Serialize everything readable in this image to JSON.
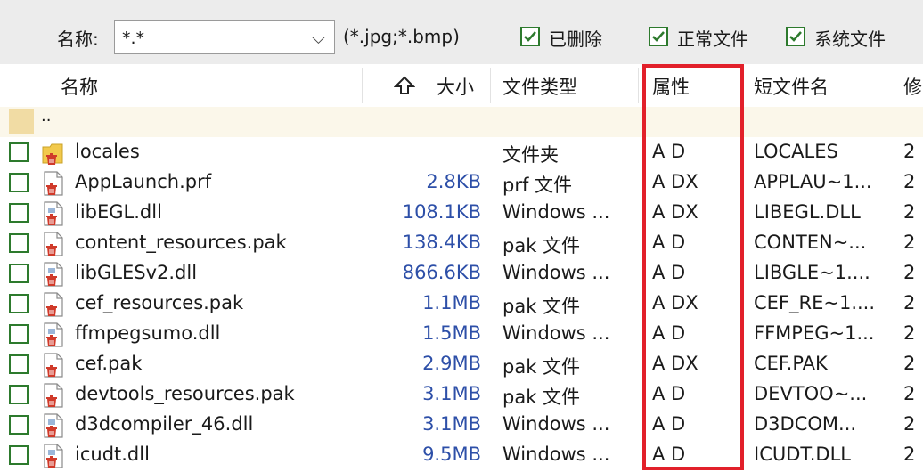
{
  "filter": {
    "name_label": "名称:",
    "pattern_value": "*.*",
    "pattern_hint": "(*.jpg;*.bmp)",
    "checkboxes": [
      {
        "label": "已删除",
        "checked": true
      },
      {
        "label": "正常文件",
        "checked": true
      },
      {
        "label": "系统文件",
        "checked": true
      }
    ]
  },
  "columns": {
    "name": "名称",
    "size": "大小",
    "type": "文件类型",
    "attr": "属性",
    "short": "短文件名",
    "more": "修"
  },
  "parent_row": {
    "label": ".."
  },
  "rows": [
    {
      "name": "locales",
      "size": "",
      "type": "文件夹",
      "attr": "A D",
      "short": "LOCALES",
      "more": "2",
      "kind": "folder"
    },
    {
      "name": "AppLaunch.prf",
      "size": "2.8KB",
      "type": "prf 文件",
      "attr": "A DX",
      "short": "APPLAU~1...",
      "more": "2",
      "kind": "file"
    },
    {
      "name": "libEGL.dll",
      "size": "108.1KB",
      "type": "Windows ...",
      "attr": "A DX",
      "short": "LIBEGL.DLL",
      "more": "2",
      "kind": "dll"
    },
    {
      "name": "content_resources.pak",
      "size": "138.4KB",
      "type": "pak 文件",
      "attr": "A D",
      "short": "CONTEN~...",
      "more": "2",
      "kind": "file"
    },
    {
      "name": "libGLESv2.dll",
      "size": "866.6KB",
      "type": "Windows ...",
      "attr": "A D",
      "short": "LIBGLE~1....",
      "more": "2",
      "kind": "dll"
    },
    {
      "name": "cef_resources.pak",
      "size": "1.1MB",
      "type": "pak 文件",
      "attr": "A DX",
      "short": "CEF_RE~1....",
      "more": "2",
      "kind": "file"
    },
    {
      "name": "ffmpegsumo.dll",
      "size": "1.5MB",
      "type": "Windows ...",
      "attr": "A D",
      "short": "FFMPEG~1...",
      "more": "2",
      "kind": "dll"
    },
    {
      "name": "cef.pak",
      "size": "2.9MB",
      "type": "pak 文件",
      "attr": "A DX",
      "short": "CEF.PAK",
      "more": "2",
      "kind": "file"
    },
    {
      "name": "devtools_resources.pak",
      "size": "3.1MB",
      "type": "pak 文件",
      "attr": "A D",
      "short": "DEVTOO~...",
      "more": "2",
      "kind": "file"
    },
    {
      "name": "d3dcompiler_46.dll",
      "size": "3.1MB",
      "type": "Windows ...",
      "attr": "A D",
      "short": "D3DCOM...",
      "more": "2",
      "kind": "dll"
    },
    {
      "name": "icudt.dll",
      "size": "9.5MB",
      "type": "Windows ...",
      "attr": "A D",
      "short": "ICUDT.DLL",
      "more": "2",
      "kind": "dll"
    }
  ],
  "colors": {
    "highlight": "#e2202a",
    "checkbox": "#2d7a2d",
    "size_text": "#2d4fa8",
    "deleted_icon": "#d03a2a"
  }
}
